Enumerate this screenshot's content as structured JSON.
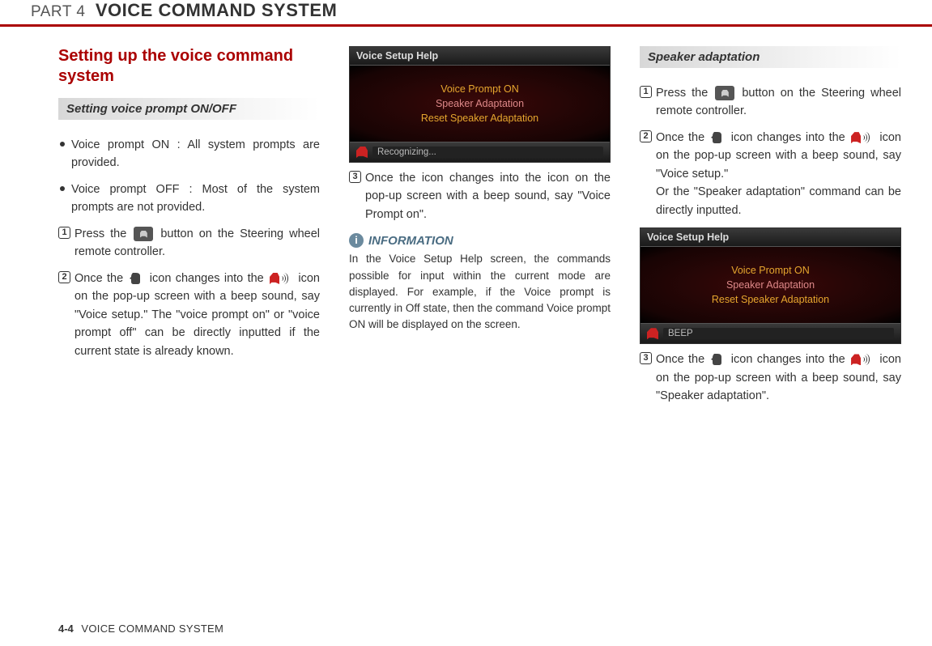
{
  "header": {
    "part": "PART 4",
    "title": "VOICE COMMAND SYSTEM"
  },
  "col1": {
    "section_title": "Setting up the voice command system",
    "sub_heading": "Setting voice prompt ON/OFF",
    "bullets": [
      "Voice prompt ON : All system prompts are provided.",
      "Voice prompt OFF : Most of the system prompts are not provided."
    ],
    "step1_a": "Press the ",
    "step1_b": " button on the Steering wheel remote controller.",
    "step2_a": "Once the ",
    "step2_b": " icon changes into the ",
    "step2_c": " icon on the pop-up screen with a beep sound, say \"Voice setup.\" The \"voice prompt on\" or \"voice prompt off\" can be directly inputted if the current state is already known."
  },
  "col2": {
    "ss": {
      "title": "Voice Setup Help",
      "lines": [
        "Voice Prompt ON",
        "Speaker Adaptation",
        "Reset Speaker Adaptation"
      ],
      "status": "Recognizing..."
    },
    "step3": "Once the  icon changes into the icon on the pop-up screen with a beep sound, say \"Voice Prompt on\".",
    "info_label": "INFORMATION",
    "info_text": "In the Voice Setup Help screen, the commands possible for input within the current mode are displayed. For example, if the Voice prompt is currently in Off state, then the command Voice prompt ON will be displayed on the screen."
  },
  "col3": {
    "sub_heading": "Speaker adaptation",
    "step1_a": "Press the ",
    "step1_b": " button on the Steering wheel remote controller.",
    "step2_a": "Once the ",
    "step2_b": " icon changes into the ",
    "step2_c": " icon on the pop-up screen with a beep sound, say \"Voice setup.\"",
    "step2_d": "Or the \"Speaker adaptation\" command can be directly inputted.",
    "ss": {
      "title": "Voice Setup Help",
      "lines": [
        "Voice Prompt ON",
        "Speaker Adaptation",
        "Reset Speaker Adaptation"
      ],
      "status": "BEEP"
    },
    "step3_a": "Once the ",
    "step3_b": " icon changes into the ",
    "step3_c": "  icon on the pop-up screen with a beep sound, say \"Speaker adaptation\"."
  },
  "footer": {
    "page": "4-4",
    "title": "VOICE COMMAND SYSTEM"
  }
}
